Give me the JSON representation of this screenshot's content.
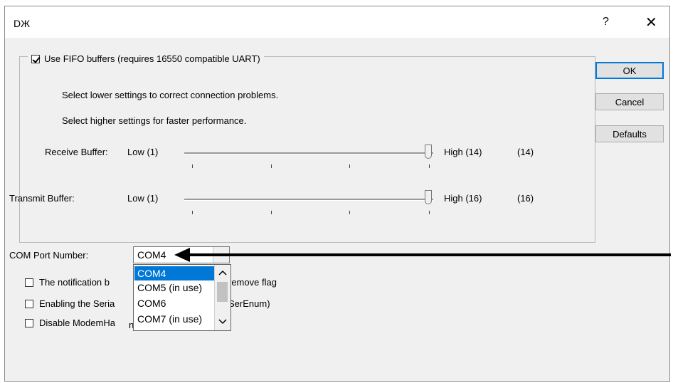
{
  "window": {
    "title": "DЖ",
    "help_label": "?",
    "close_label": "✕"
  },
  "fifo": {
    "checkbox_label": "Use FIFO buffers (requires 16550 compatible UART)",
    "checked": true,
    "hint1": "Select lower settings to correct connection problems.",
    "hint2": "Select higher settings for faster performance."
  },
  "receive": {
    "label": "Receive Buffer:",
    "low": "Low (1)",
    "high": "High (14)",
    "current": "(14)",
    "level": 1.0
  },
  "transmit": {
    "label": "Transmit Buffer:",
    "low": "Low (1)",
    "high": "High (16)",
    "current": "(16)",
    "level": 1.0
  },
  "buttons": {
    "ok": "OK",
    "cancel": "Cancel",
    "defaults": "Defaults"
  },
  "com": {
    "label": "COM Port Number:",
    "value": "COM4",
    "options": [
      "COM4",
      "COM5 (in use)",
      "COM6",
      "COM7 (in use)"
    ]
  },
  "options": {
    "notify_prefix": "The notification b",
    "notify_suffix": "remove flag",
    "serial_prefix": "Enabling the Seria",
    "serial_suffix": "SerEnum)",
    "modem_prefix": "Disable ModemHa",
    "modem_suffix": "ndShake"
  },
  "colors": {
    "accent": "#0078d7",
    "face": "#f0f0f0"
  },
  "icons": {
    "close": "close-icon",
    "help": "help-icon",
    "scroll_up": "chevron-up-icon",
    "scroll_down": "chevron-down-icon",
    "combo_arrow": "chevron-down-icon"
  }
}
